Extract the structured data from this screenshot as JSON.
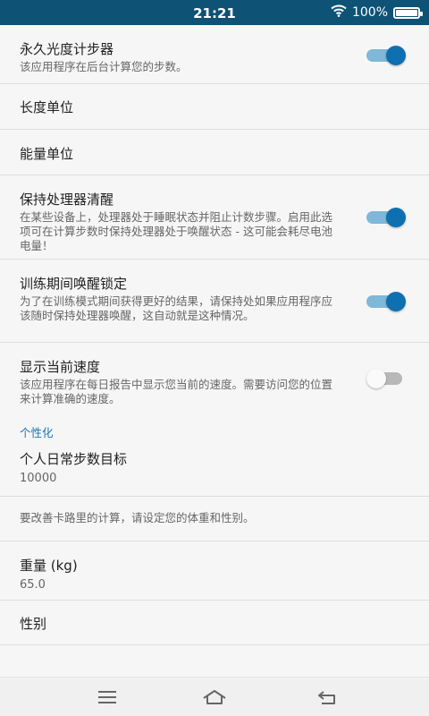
{
  "status_bar": {
    "time": "21:21",
    "battery": "100%"
  },
  "settings": {
    "persistent_pedometer": {
      "title": "永久光度计步器",
      "summary": "该应用程序在后台计算您的步数。",
      "enabled": true
    },
    "length_unit": {
      "title": "长度单位"
    },
    "energy_unit": {
      "title": "能量单位"
    },
    "keep_cpu_awake": {
      "title": "保持处理器清醒",
      "summary": "在某些设备上，处理器处于睡眠状态并阻止计数步骤。启用此选项可在计算步数时保持处理器处于唤醒状态 - 这可能会耗尽电池电量！",
      "enabled": true
    },
    "wake_lock_training": {
      "title": "训练期间唤醒锁定",
      "summary": "为了在训练模式期间获得更好的结果，请保持处如果应用程序应该随时保持处理器唤醒，这自动就是这种情况。",
      "enabled": true
    },
    "show_speed": {
      "title": "显示当前速度",
      "summary": "该应用程序在每日报告中显示您当前的速度。需要访问您的位置来计算准确的速度。",
      "enabled": false
    }
  },
  "personalization": {
    "header": "个性化",
    "daily_goal": {
      "title": "个人日常步数目标",
      "value": "10000"
    },
    "hint": "要改善卡路里的计算，请设定您的体重和性别。",
    "weight": {
      "title": "重量 (kg)",
      "value": "65.0"
    },
    "gender": {
      "title": "性别"
    }
  },
  "colors": {
    "accent": "#0e70b0",
    "status_bar": "#0e5275",
    "section_header": "#1877b6"
  },
  "nav_bar": {
    "icons": [
      "menu-icon",
      "home-icon",
      "back-icon"
    ]
  }
}
